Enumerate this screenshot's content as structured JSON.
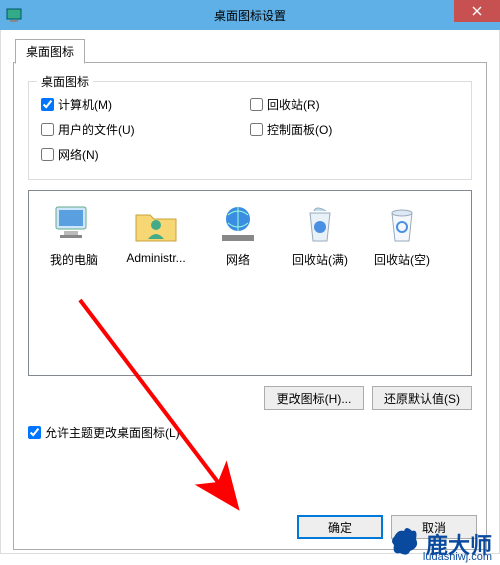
{
  "window": {
    "title": "桌面图标设置"
  },
  "tab": {
    "label": "桌面图标"
  },
  "groupbox": {
    "legend": "桌面图标",
    "checks": {
      "computer": "计算机(M)",
      "recycle": "回收站(R)",
      "userfiles": "用户的文件(U)",
      "controlpanel": "控制面板(O)",
      "network": "网络(N)"
    }
  },
  "icons": {
    "computer": "我的电脑",
    "admin": "Administr...",
    "network": "网络",
    "recycle_full": "回收站(满)",
    "recycle_empty": "回收站(空)"
  },
  "buttons": {
    "change_icon": "更改图标(H)...",
    "restore_default": "还原默认值(S)",
    "ok": "确定",
    "cancel": "取消"
  },
  "allow_themes": "允许主题更改桌面图标(L)",
  "watermark": {
    "name": "鹿大师",
    "url": "ludashiwj.com"
  }
}
